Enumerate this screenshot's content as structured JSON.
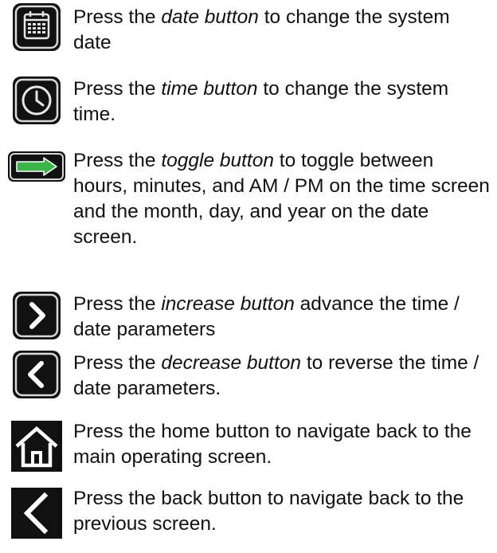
{
  "items": [
    {
      "icon": "calendar-icon",
      "pre": "Press the ",
      "em": "date button",
      "post": " to change the system date"
    },
    {
      "icon": "clock-icon",
      "pre": "Press the ",
      "em": "time button",
      "post": " to change the system time."
    },
    {
      "icon": "toggle-arrow-icon",
      "pre": "Press the ",
      "em": "toggle button",
      "post": " to toggle between hours, minutes, and AM / PM on the time screen and the month, day, and year on the date screen."
    },
    {
      "icon": "chevron-right-icon",
      "pre": "Press the ",
      "em": "increase button",
      "post": " advance the time / date parameters"
    },
    {
      "icon": "chevron-left-icon",
      "pre": "Press the ",
      "em": "decrease button",
      "post": " to reverse the time / date parameters."
    },
    {
      "icon": "home-icon",
      "pre": "Press the home button to navigate back to the main operating screen.",
      "em": "",
      "post": ""
    },
    {
      "icon": "back-arrow-icon",
      "pre": "Press the back button to navigate back to the previous screen.",
      "em": "",
      "post": ""
    }
  ],
  "colors": {
    "icon_bg": "#111111",
    "icon_border": "#d8d8d8",
    "toggle_green": "#3bb54a"
  }
}
